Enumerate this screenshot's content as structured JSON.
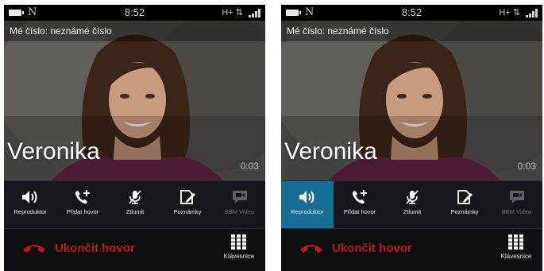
{
  "screens": [
    {
      "status": {
        "notification": "N",
        "time": "8:52",
        "network": "H+ ⇅"
      },
      "my_number": "Mé číslo: neznámé číslo",
      "contact_name": "Veronika",
      "call_timer": "0:03",
      "actions": [
        {
          "label": "Reproduktor",
          "icon": "speaker-icon",
          "active": false
        },
        {
          "label": "Přidat hovor",
          "icon": "add-call-icon",
          "active": false
        },
        {
          "label": "Ztlumit",
          "icon": "mic-muted-icon",
          "active": false
        },
        {
          "label": "Poznámky",
          "icon": "notes-icon",
          "active": false
        },
        {
          "label": "BBM Video",
          "icon": "bbm-video-icon",
          "active": false,
          "disabled": true
        }
      ],
      "end_call": "Ukončit hovor",
      "keypad": "Klávesnice"
    },
    {
      "status": {
        "notification": "N",
        "time": "8:52",
        "network": "H+ ⇅"
      },
      "my_number": "Mé číslo: neznámé číslo",
      "contact_name": "Veronika",
      "call_timer": "0:03",
      "actions": [
        {
          "label": "Reproduktor",
          "icon": "speaker-icon",
          "active": true
        },
        {
          "label": "Přidat hovor",
          "icon": "add-call-icon",
          "active": false
        },
        {
          "label": "Ztlumit",
          "icon": "mic-muted-icon",
          "active": false
        },
        {
          "label": "Poznámky",
          "icon": "notes-icon",
          "active": false
        },
        {
          "label": "BBM Video",
          "icon": "bbm-video-icon",
          "active": false,
          "disabled": true
        }
      ],
      "end_call": "Ukončit hovor",
      "keypad": "Klávesnice"
    }
  ],
  "colors": {
    "accent": "#166f92",
    "end_call": "#c0161c",
    "background": "#0d0f12"
  }
}
